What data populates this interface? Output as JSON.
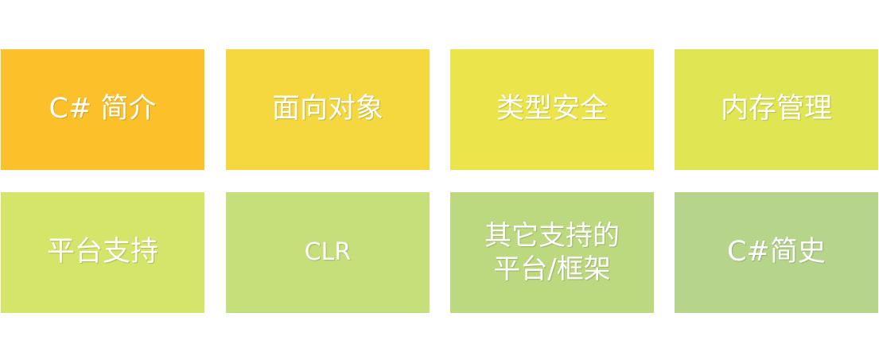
{
  "tiles": [
    {
      "label": "C# 简介",
      "color": "#fcc12a"
    },
    {
      "label": "面向对象",
      "color": "#f5d840"
    },
    {
      "label": "类型安全",
      "color": "#ebe44a"
    },
    {
      "label": "内存管理",
      "color": "#e0e653"
    },
    {
      "label": "平台支持",
      "color": "#d4e569"
    },
    {
      "label": "CLR",
      "color": "#c5df7a"
    },
    {
      "label": "其它支持的\n平台/框架",
      "color": "#bcd97f"
    },
    {
      "label": "C#简史",
      "color": "#b6d58b"
    }
  ]
}
